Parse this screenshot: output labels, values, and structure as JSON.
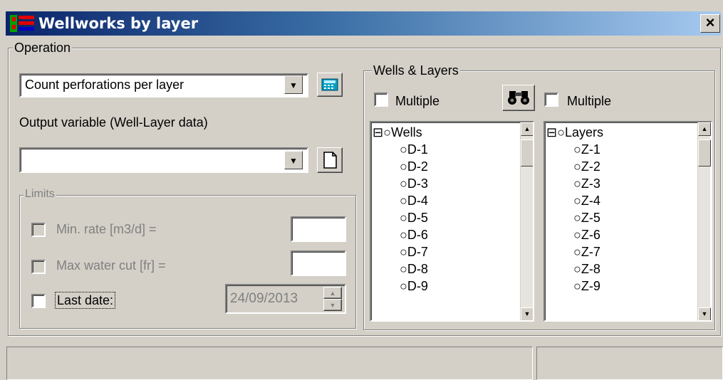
{
  "window": {
    "title": "Wellworks by layer",
    "close": "×"
  },
  "operation": {
    "group_label": "Operation",
    "combo_value": "Count perforations per layer",
    "output_label": "Output variable (Well-Layer data)",
    "output_value": ""
  },
  "limits": {
    "group_label": "Limits",
    "min_rate_label": "Min. rate [m3/d] =",
    "max_water_cut_label": "Max water cut [fr] =",
    "last_date_label": "Last date:",
    "last_date_value": "24/09/2013"
  },
  "wells_layers": {
    "group_label": "Wells & Layers",
    "wells_multiple_label": "Multiple",
    "layers_multiple_label": "Multiple",
    "wells_root": "Wells",
    "wells": [
      "D-1",
      "D-2",
      "D-3",
      "D-4",
      "D-5",
      "D-6",
      "D-7",
      "D-8",
      "D-9"
    ],
    "layers_root": "Layers",
    "layers": [
      "Z-1",
      "Z-2",
      "Z-3",
      "Z-4",
      "Z-5",
      "Z-6",
      "Z-7",
      "Z-8",
      "Z-9"
    ]
  },
  "icons": {
    "app": "app-icon",
    "calculator": "calculator-icon",
    "new_document": "new-document-icon",
    "binoculars": "binoculars-icon"
  },
  "colors": {
    "title_start": "#0a246a",
    "title_end": "#a6caf0",
    "face": "#d4d0c8"
  }
}
